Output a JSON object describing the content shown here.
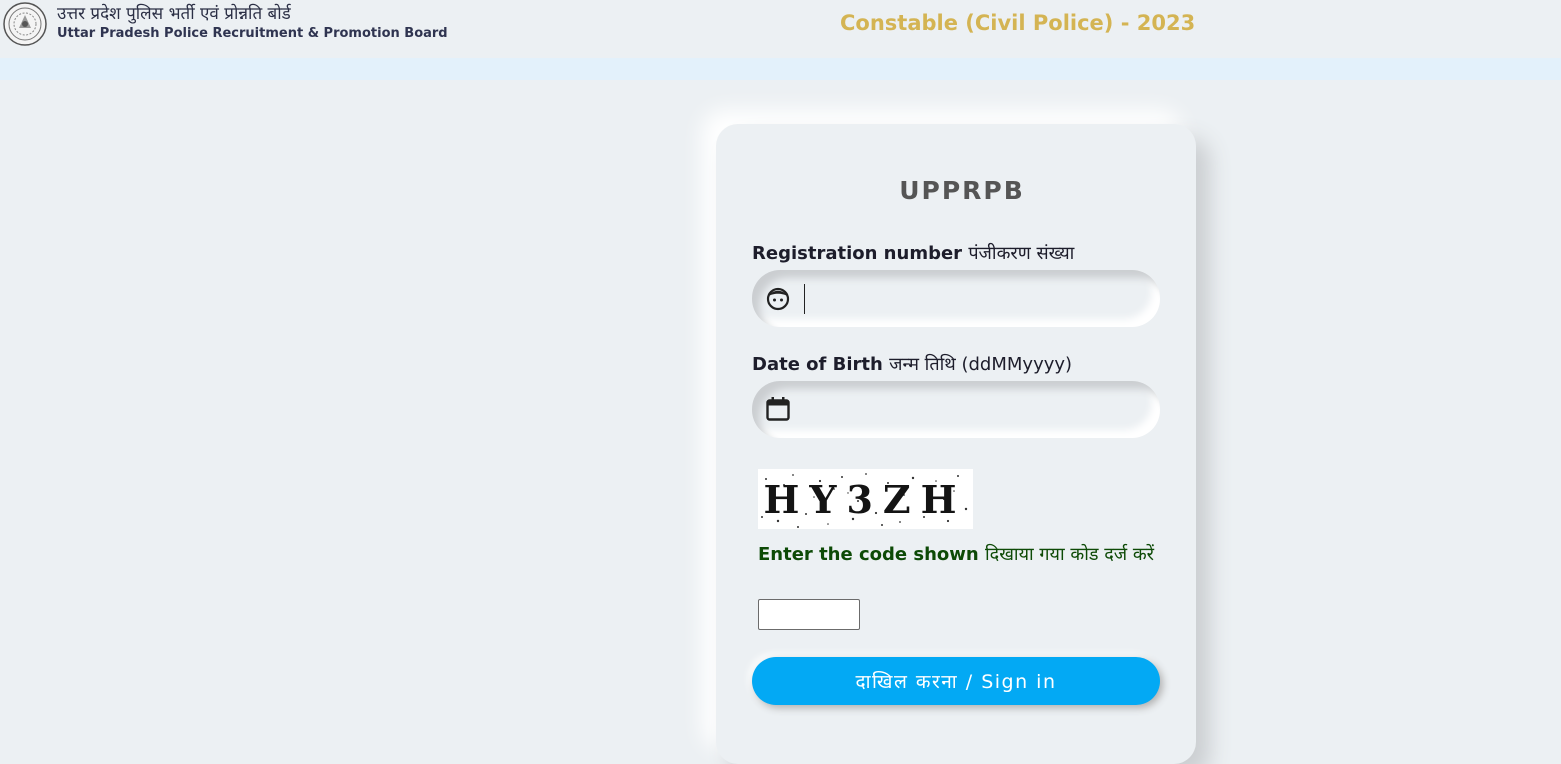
{
  "header": {
    "org_name_hindi": "उत्तर प्रदेश पुलिस भर्ती एवं प्रोन्नति बोर्ड",
    "org_name_english": "Uttar Pradesh Police Recruitment & Promotion Board",
    "exam_title": "Constable (Civil Police) - 2023",
    "logo_icon": "police-emblem-seal"
  },
  "login": {
    "title": "UPPRPB",
    "registration": {
      "label_en": "Registration number",
      "label_hi": "पंजीकरण संख्या",
      "value": "",
      "icon": "face-icon"
    },
    "dob": {
      "label_en": "Date of Birth",
      "label_hi": "जन्म तिथि (ddMMyyyy)",
      "value": "",
      "icon": "calendar-icon"
    },
    "captcha": {
      "image_text": "HY3ZH",
      "label_en": "Enter the code shown",
      "label_hi": "दिखाया गया कोड दर्ज करें",
      "value": ""
    },
    "signin_label": "दाखिल करना / Sign in"
  },
  "colors": {
    "background": "#ecf0f3",
    "accent_gold": "#d4b453",
    "button_blue": "#03a9f4",
    "captcha_label_green": "#0d4a06",
    "top_strip": "#e3f1fb"
  }
}
